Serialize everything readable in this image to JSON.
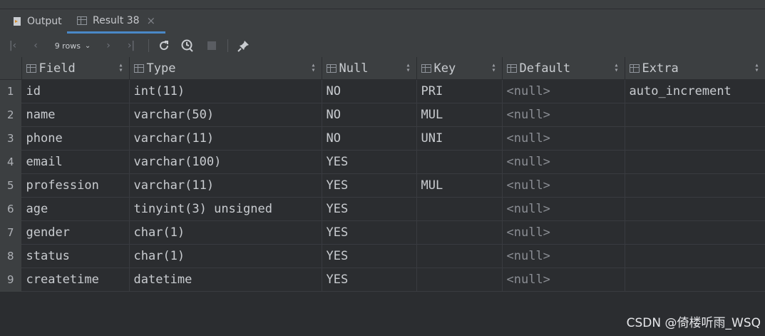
{
  "tabs": [
    {
      "label": "Output",
      "icon": "output-icon"
    },
    {
      "label": "Result 38",
      "icon": "table-icon",
      "close": "×"
    }
  ],
  "toolbar": {
    "rows_label": "9 rows"
  },
  "table": {
    "columns": [
      "Field",
      "Type",
      "Null",
      "Key",
      "Default",
      "Extra"
    ],
    "rows": [
      {
        "num": "1",
        "cells": [
          "id",
          "int(11)",
          "NO",
          "PRI",
          "<null>",
          "auto_increment"
        ]
      },
      {
        "num": "2",
        "cells": [
          "name",
          "varchar(50)",
          "NO",
          "MUL",
          "<null>",
          ""
        ]
      },
      {
        "num": "3",
        "cells": [
          "phone",
          "varchar(11)",
          "NO",
          "UNI",
          "<null>",
          ""
        ]
      },
      {
        "num": "4",
        "cells": [
          "email",
          "varchar(100)",
          "YES",
          "",
          "<null>",
          ""
        ]
      },
      {
        "num": "5",
        "cells": [
          "profession",
          "varchar(11)",
          "YES",
          "MUL",
          "<null>",
          ""
        ]
      },
      {
        "num": "6",
        "cells": [
          "age",
          "tinyint(3) unsigned",
          "YES",
          "",
          "<null>",
          ""
        ]
      },
      {
        "num": "7",
        "cells": [
          "gender",
          "char(1)",
          "YES",
          "",
          "<null>",
          ""
        ]
      },
      {
        "num": "8",
        "cells": [
          "status",
          "char(1)",
          "YES",
          "",
          "<null>",
          ""
        ]
      },
      {
        "num": "9",
        "cells": [
          "createtime",
          "datetime",
          "YES",
          "",
          "<null>",
          ""
        ]
      }
    ]
  },
  "watermark": "CSDN @倚楼听雨_WSQ",
  "colors": {
    "accent": "#4a88c7",
    "background": "#2b2d30",
    "panel": "#3c3f41"
  }
}
